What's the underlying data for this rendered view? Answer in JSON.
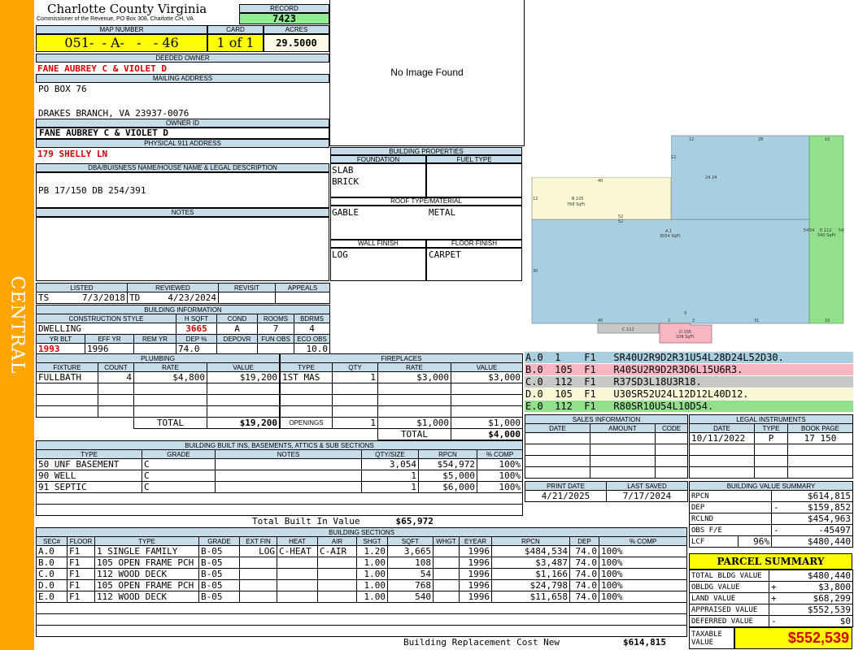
{
  "sidebar": {
    "label": "CENTRAL",
    "color": "#ffa500"
  },
  "header": {
    "county": "Charlotte County Virginia",
    "commissioner": "Commissioner of the Revenue, PO Box 308, Charlotte CH, VA",
    "record_label": "RECORD",
    "record": "7423",
    "map_number_label": "MAP NUMBER",
    "map_number": "051-  - A-   -   - 46",
    "card_label": "CARD",
    "card": "1 of 1",
    "acres_label": "ACRES",
    "acres": "29.5000"
  },
  "owner": {
    "deeded_owner_label": "DEEDED OWNER",
    "deeded_owner": "FANE AUBREY C & VIOLET D",
    "mailing_address_label": "MAILING ADDRESS",
    "mailing_line1": "PO BOX 76",
    "mailing_line2": "DRAKES BRANCH, VA 23937-0076",
    "owner_id_label": "OWNER ID",
    "owner_id": "FANE AUBREY C & VIOLET D",
    "physical_address_label": "PHYSICAL 911 ADDRESS",
    "physical_address": "179 SHELLY LN",
    "dba_label": "DBA/BUISNESS NAME/HOUSE NAME & LEGAL DESCRIPTION",
    "legal_description": "PB 17/150 DB 254/391",
    "notes_label": "NOTES"
  },
  "image": {
    "placeholder": "No Image Found"
  },
  "building_properties": {
    "title": "BUILDING PROPERTIES",
    "foundation_label": "FOUNDATION",
    "fuel_type_label": "FUEL TYPE",
    "foundation_1": "SLAB",
    "foundation_2": "BRICK",
    "roof_label": "ROOF TYPE/MATERIAL",
    "roof_type": "GABLE",
    "roof_material": "METAL",
    "wall_label": "WALL FINISH",
    "floor_label": "FLOOR FINISH",
    "wall": "LOG",
    "floor": "CARPET"
  },
  "review": {
    "listed_label": "LISTED",
    "reviewed_label": "REVIEWED",
    "revisit_label": "REVISIT",
    "appeals_label": "APPEALS",
    "listed_by": "TS",
    "listed_date": "7/3/2018",
    "reviewed_by": "TD",
    "reviewed_date": "4/23/2024"
  },
  "building_info": {
    "title": "BUILDING INFORMATION",
    "construction_label": "CONSTRUCTION STYLE",
    "hsqft_label": "H SQFT",
    "cond_label": "COND",
    "rooms_label": "ROOMS",
    "bdrms_label": "BDRMS",
    "construction": "DWELLING",
    "hsqft": "3665",
    "cond": "A",
    "rooms": "7",
    "bdrms": "4",
    "yrblt_label": "YR BLT",
    "effyr_label": "EFF YR",
    "remyr_label": "REM YR",
    "dep_label": "DEP %",
    "depovr_label": "DEPOVR",
    "funobs_label": "FUN OBS",
    "ecoobs_label": "ECO OBS",
    "yrblt": "1993",
    "effyr": "1996",
    "remyr": "",
    "dep": "74.0",
    "depovr": "",
    "funobs": "",
    "ecoobs": "10.0"
  },
  "plumbing": {
    "title": "PLUMBING",
    "headers": [
      "FIXTURE",
      "COUNT",
      "RATE",
      "VALUE"
    ],
    "rows": [
      [
        "FULLBATH",
        "4",
        "$4,800",
        "$19,200"
      ]
    ],
    "total_label": "TOTAL",
    "total": "$19,200"
  },
  "fireplaces": {
    "title": "FIREPLACES",
    "headers": [
      "TYPE",
      "QTY",
      "RATE",
      "VALUE"
    ],
    "rows": [
      [
        "1ST MAS",
        "1",
        "$3,000",
        "$3,000"
      ]
    ],
    "openings_label": "OPENINGS",
    "openings_qty": "1",
    "openings_rate": "$1,000",
    "openings_value": "$1,000",
    "total_label": "TOTAL",
    "total": "$4,000"
  },
  "sketch": {
    "labels": {
      "a": "A.1",
      "a_area": "3054 SqFt",
      "b": "B.105",
      "b_area": "768 SqFt",
      "c": "C.112",
      "d": "D.105",
      "d_area": "108 SqFt",
      "e": "E.112",
      "e_area": "540 SqFt"
    },
    "dims": [
      "12",
      "28",
      "10",
      "12",
      "40",
      "24",
      "24",
      "12",
      "52",
      "52",
      "30",
      "54",
      "54",
      "54",
      "40",
      "2",
      "9",
      "2",
      "31",
      "10"
    ],
    "colors": {
      "a": "#a8cfe0",
      "b": "#fcf8d6",
      "c": "#c8c8c8",
      "d": "#f7b6c2",
      "e": "#92e08c"
    }
  },
  "segments": [
    {
      "text": "A.0  1    F1   SR40U2R9D2R31U54L28D24L52D30.",
      "color": "#a8cfe0"
    },
    {
      "text": "B.0  105  F1   R40SU2R9D2R3D6L15U6R3.",
      "color": "#f7b6c2"
    },
    {
      "text": "C.0  112  F1   R37SD3L18U3R18.",
      "color": "#c8c8c8"
    },
    {
      "text": "D.0  105  F1   U30SR52U24L12D12L40D12.",
      "color": "#fcf8d6"
    },
    {
      "text": "E.0  112  F1   R80SR10U54L10D54.",
      "color": "#92e08c"
    }
  ],
  "sales": {
    "title": "SALES INFORMATION",
    "date_label": "DATE",
    "amount_label": "AMOUNT",
    "code_label": "CODE"
  },
  "legal": {
    "title": "LEGAL INSTRUMENTS",
    "date_label": "DATE",
    "type_label": "TYPE",
    "book_label": "BOOK PAGE",
    "rows": [
      [
        "10/11/2022",
        "P",
        "17 150"
      ]
    ]
  },
  "print": {
    "print_date_label": "PRINT DATE",
    "last_saved_label": "LAST SAVED",
    "print_date": "4/21/2025",
    "last_saved": "7/17/2024"
  },
  "value_summary": {
    "title": "BUILDING VALUE SUMMARY",
    "rows": [
      {
        "label": "RPCN",
        "sign": "",
        "value": "$614,815"
      },
      {
        "label": "DEP",
        "sign": "-",
        "value": "$159,852"
      },
      {
        "label": "RCLND",
        "sign": "",
        "value": "$454,963"
      },
      {
        "label": "OBS F/E",
        "sign": "-",
        "value": "-45497"
      },
      {
        "label": "LCF",
        "pct": "96%",
        "sign": "",
        "value": "$480,440"
      }
    ]
  },
  "parcel_summary": {
    "title": "PARCEL SUMMARY",
    "rows": [
      {
        "label": "TOTAL BLDG VALUE",
        "sign": "",
        "value": "$480,440"
      },
      {
        "label": "OBLDG VALUE",
        "sign": "+",
        "value": "$3,800"
      },
      {
        "label": "LAND VALUE",
        "sign": "+",
        "value": "$68,299"
      },
      {
        "label": "APPRAISED VALUE",
        "sign": "",
        "value": "$552,539"
      },
      {
        "label": "DEFERRED VALUE",
        "sign": "-",
        "value": "$0"
      }
    ],
    "taxable_label": "TAXABLE VALUE",
    "taxable": "$552,539"
  },
  "builtins": {
    "title": "BUILDING BUILT INS, BASEMENTS, ATTICS & SUB SECTIONS",
    "headers": [
      "TYPE",
      "GRADE",
      "NOTES",
      "QTY/SIZE",
      "RPCN",
      "% COMP"
    ],
    "rows": [
      [
        "50 UNF BASEMENT",
        "C",
        "",
        "3,054",
        "$54,972",
        "100%"
      ],
      [
        "90 WELL",
        "C",
        "",
        "1",
        "$5,000",
        "100%"
      ],
      [
        "91 SEPTIC",
        "C",
        "",
        "1",
        "$6,000",
        "100%"
      ]
    ],
    "total_label": "Total Built In Value",
    "total": "$65,972"
  },
  "sections": {
    "title": "BUILDING SECTIONS",
    "headers": [
      "SEC#",
      "FLOOR",
      "TYPE",
      "GRADE",
      "EXT FIN",
      "HEAT",
      "AIR",
      "SHGT",
      "SQFT",
      "WHGT",
      "EYEAR",
      "RPCN",
      "DEP",
      "% COMP"
    ],
    "rows": [
      [
        "A.0",
        "F1",
        "1 SINGLE FAMILY",
        "B-05",
        "LOG",
        "C-HEAT",
        "C-AIR",
        "1.20",
        "3,665",
        "",
        "1996",
        "$484,534",
        "74.0",
        "100%"
      ],
      [
        "B.0",
        "F1",
        "105 OPEN FRAME PCH",
        "B-05",
        "",
        "",
        "",
        "1.00",
        "108",
        "",
        "1996",
        "$3,487",
        "74.0",
        "100%"
      ],
      [
        "C.0",
        "F1",
        "112 WOOD DECK",
        "B-05",
        "",
        "",
        "",
        "1.00",
        "54",
        "",
        "1996",
        "$1,166",
        "74.0",
        "100%"
      ],
      [
        "D.0",
        "F1",
        "105 OPEN FRAME PCH",
        "B-05",
        "",
        "",
        "",
        "1.00",
        "768",
        "",
        "1996",
        "$24,798",
        "74.0",
        "100%"
      ],
      [
        "E.0",
        "F1",
        "112 WOOD DECK",
        "B-05",
        "",
        "",
        "",
        "1.00",
        "540",
        "",
        "1996",
        "$11,658",
        "74.0",
        "100%"
      ]
    ],
    "rcn_label": "Building Replacement Cost New",
    "rcn": "$614,815"
  }
}
